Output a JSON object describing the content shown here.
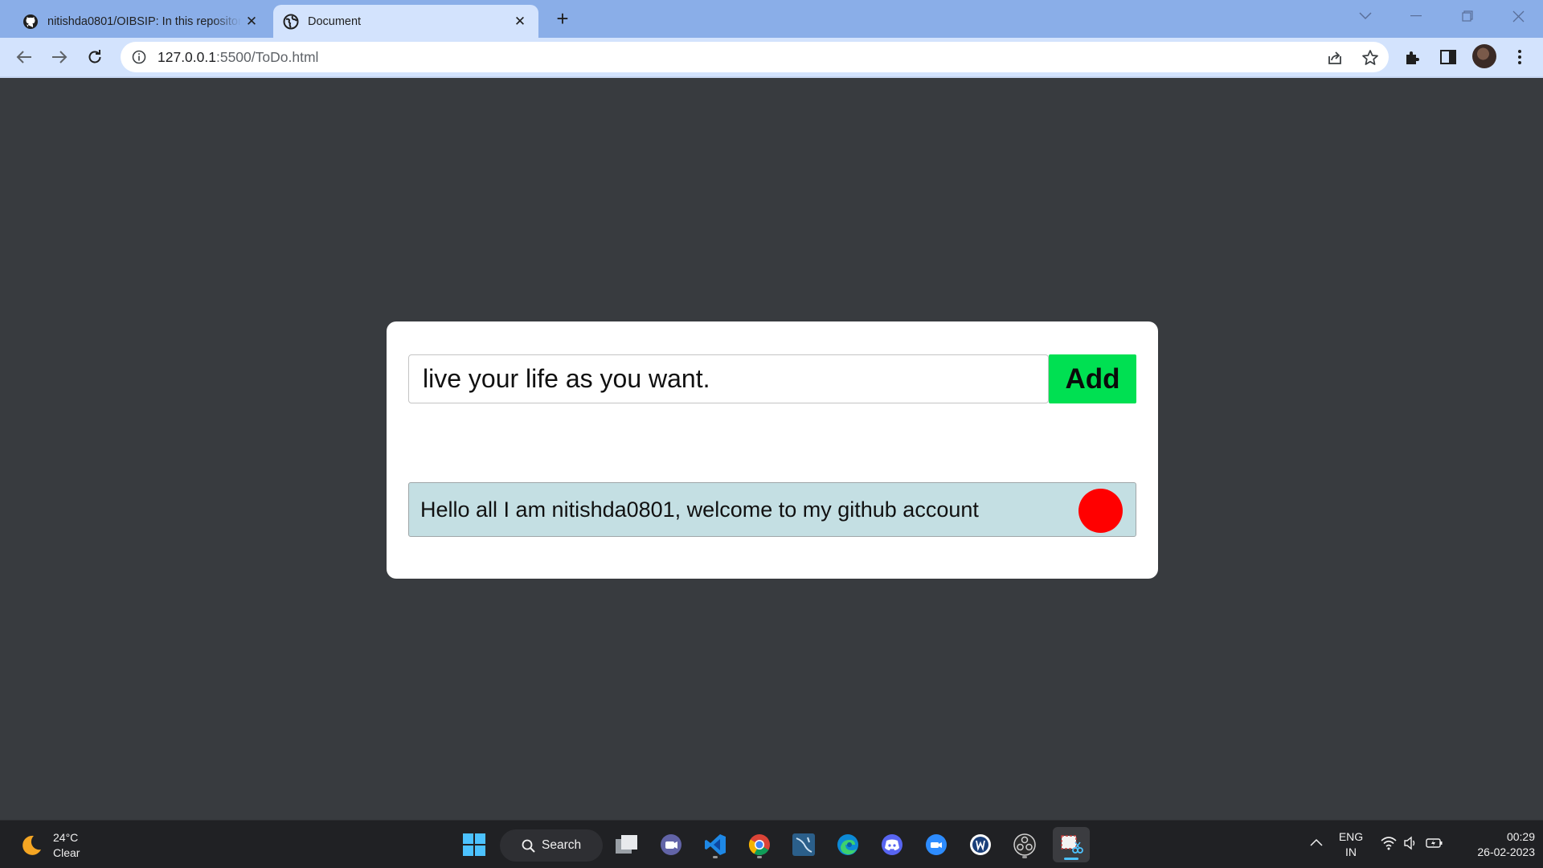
{
  "browser": {
    "tabs": [
      {
        "title": "nitishda0801/OIBSIP: In this repository",
        "favicon": "github-icon",
        "active": false
      },
      {
        "title": "Document",
        "favicon": "globe-icon",
        "active": true
      }
    ],
    "address": {
      "host": "127.0.0.1",
      "path": ":5500/ToDo.html"
    }
  },
  "app": {
    "input_value": "live your life as you want.",
    "add_label": "Add",
    "todos": [
      {
        "text": "Hello all I am nitishda0801, welcome to my github account",
        "marker_color": "#ff0000"
      }
    ],
    "colors": {
      "background": "#383b3f",
      "add_button": "#00e052",
      "todo_item": "#c4dfe3"
    }
  },
  "taskbar": {
    "weather": {
      "temp": "24°C",
      "condition": "Clear"
    },
    "search_label": "Search",
    "apps": [
      "start-icon",
      "search",
      "task-view-icon",
      "teams-icon",
      "vscode-icon",
      "chrome-icon",
      "mysql-workbench-icon",
      "edge-icon",
      "discord-icon",
      "zoom-icon",
      "word-icon",
      "obs-icon",
      "snipping-tool-icon"
    ],
    "language": {
      "line1": "ENG",
      "line2": "IN"
    },
    "clock": {
      "time": "00:29",
      "date": "26-02-2023"
    }
  }
}
